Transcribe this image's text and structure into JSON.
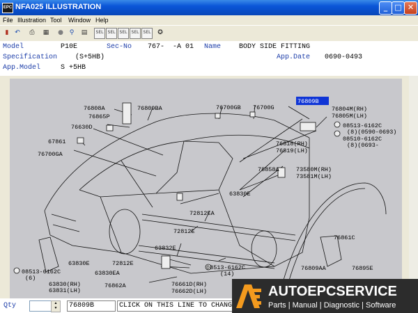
{
  "window": {
    "app_icon_label": "EPC",
    "title": "NFA025  ILLUSTRATION",
    "minimize": "_",
    "maximize": "□",
    "close": "✕"
  },
  "menu": [
    "File",
    "Illustration",
    "Tool",
    "Window",
    "Help"
  ],
  "toolbar_icons": [
    "exit-icon",
    "back-icon",
    "print-icon",
    "calculator-icon",
    "dot-icon",
    "search-icon",
    "book-icon",
    "sel-1",
    "sel-2",
    "sel-3",
    "sel-4",
    "sel-5",
    "light-bulb-icon"
  ],
  "toolbar_box_labels": [
    "SEL",
    "SEL",
    "SEL",
    "SEL",
    "SEL"
  ],
  "info": {
    "model_label": "Model",
    "model_value": "P10E",
    "secno_label": "Sec-No",
    "secno_value": "767-  -A 01",
    "name_label": "Name",
    "name_value": "BODY SIDE FITTING",
    "spec_label": "Specification",
    "spec_value": "(S+5HB)",
    "appdate_label": "App.Date",
    "appdate_value": "0690-0493",
    "appmodel_label": "App.Model",
    "appmodel_value": "S +5HB"
  },
  "callouts": {
    "c76808A": "76808A",
    "c76865P": "76865P",
    "c76809BA": "76809BA",
    "c76700GB": "76700GB",
    "c76700G": "76700G",
    "c76809B": "76809B",
    "c76804M": "76804M(RH)",
    "c76805M": "76805M(LH)",
    "c08513": "08513-6162C",
    "c08513q": "(8)(0590-0693)",
    "c08510": "08510-6162C",
    "c08510q": "(8)(0693-",
    "c76630D": "76630D",
    "c67861": "67861",
    "c76700GA": "76700GA",
    "c76818": "76818(RH)",
    "c76819": "76819(LH)",
    "c78858A": "78858A",
    "c73580M": "73580M(RH)",
    "c73581M": "73581M(LH)",
    "c63830E_a": "63830E",
    "c72812EA": "72812EA",
    "c72812E_a": "72812E",
    "c63832E": "63832E",
    "c72812E_b": "72812E",
    "c08513b": "08513-6162C",
    "c08513bq": "(14)",
    "c63830EA": "63830EA",
    "c76862A": "76862A",
    "c76661D": "76661D(RH)",
    "c76662D": "76662D(LH)",
    "c08513c": "08513-6162C",
    "c08513cq": "(6)",
    "c63830E_b": "63830E",
    "c63830RH": "63830(RH)",
    "c63831LH": "63831(LH)",
    "c76861C": "76861C",
    "c76809AA": "76809AA",
    "c76895E": "76895E"
  },
  "status": {
    "qty_label": "Qty",
    "qty_value": "",
    "part_no": "76809B",
    "message": "CLICK ON THIS LINE TO CHANGE"
  },
  "banner": {
    "brand": "AUTOEPCSERVICE",
    "tagline": "Parts | Manual | Diagnostic | Software"
  }
}
